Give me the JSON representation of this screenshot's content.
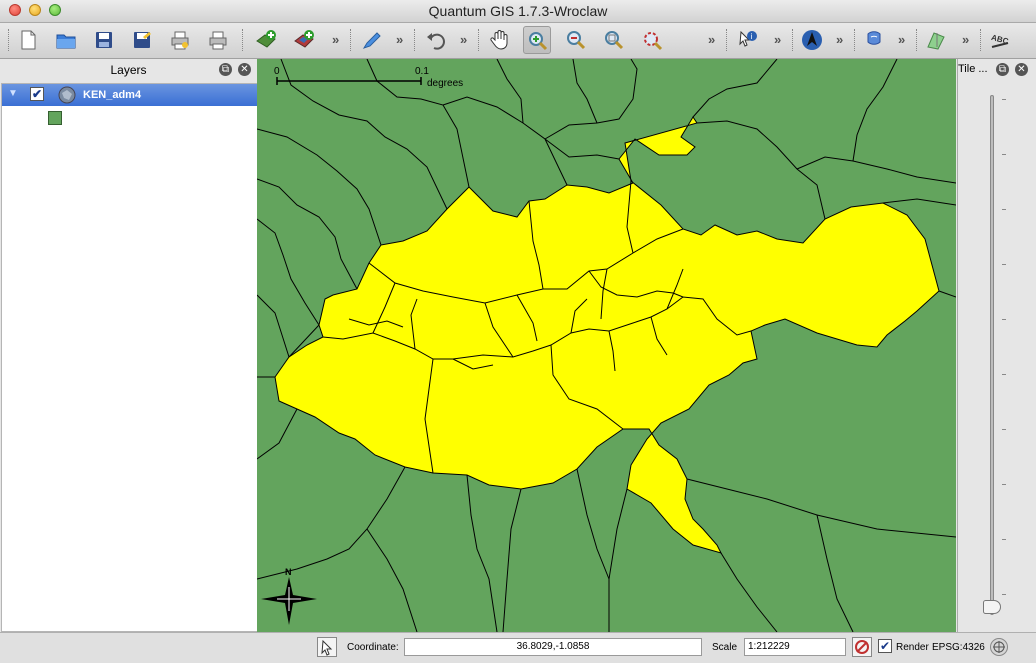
{
  "window": {
    "title": "Quantum GIS 1.7.3-Wroclaw"
  },
  "toolbar": {
    "icons": [
      "new-project-icon",
      "open-project-icon",
      "save-project-icon",
      "save-as-icon",
      "print-composer-icon",
      "print-icon",
      "add-vector-layer-icon",
      "add-raster-layer-icon",
      "digitize-icon",
      "undo-icon",
      "pan-icon",
      "zoom-in-icon",
      "zoom-out-icon",
      "zoom-full-icon",
      "zoom-last-icon",
      "identify-icon",
      "north-arrow-icon",
      "python-icon",
      "gps-icon",
      "label-icon"
    ]
  },
  "layers_panel": {
    "title": "Layers",
    "layers": [
      {
        "name": "KEN_adm4",
        "checked": true,
        "symbol_color": "#63a45d"
      }
    ]
  },
  "map": {
    "background_color": "#63a45d",
    "highlight_color": "#ffff00",
    "scalebar": {
      "start": "0",
      "end": "0.1",
      "unit": "degrees"
    },
    "north_label": "N"
  },
  "tile_panel": {
    "title": "Tile ..."
  },
  "statusbar": {
    "coordinate_label": "Coordinate:",
    "coordinate_value": "36.8029,-1.0858",
    "scale_label": "Scale",
    "scale_value": "1:212229",
    "render_label": "Render",
    "render_checked": true,
    "crs": "EPSG:4326"
  }
}
